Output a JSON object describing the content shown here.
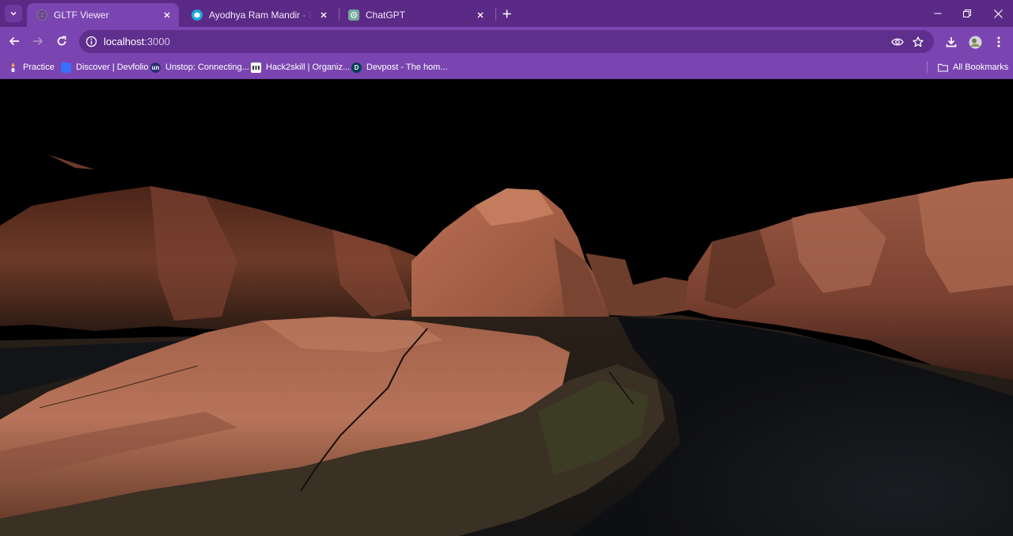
{
  "browser": {
    "tabs": [
      {
        "title": "GLTF Viewer",
        "active": true,
        "icon": "globe-icon"
      },
      {
        "title": "Ayodhya Ram Mandir - Downlo",
        "active": false,
        "icon": "sketchfab-icon"
      },
      {
        "title": "ChatGPT",
        "active": false,
        "icon": "chatgpt-icon"
      }
    ],
    "address": {
      "host": "localhost",
      "port": ":3000"
    },
    "bookmarks": [
      {
        "label": "Practice",
        "icon": "practice-icon"
      },
      {
        "label": "Discover | Devfolio",
        "icon": "devfolio-icon"
      },
      {
        "label": "Unstop: Connecting...",
        "icon": "unstop-icon",
        "glyph": "un"
      },
      {
        "label": "Hack2skill | Organiz...",
        "icon": "hack2skill-icon"
      },
      {
        "label": "Devpost - The hom...",
        "icon": "devpost-icon",
        "glyph": "D"
      }
    ],
    "all_bookmarks_label": "All Bookmarks"
  },
  "colors": {
    "tabstrip": "#5b2a86",
    "toolbar": "#7a45b0",
    "omnibox": "#5e2f8c",
    "viewport": "#000000",
    "rock": "#a86048",
    "road": "#14161a"
  },
  "viewer": {
    "scene": "3D GLTF canyon terrain render"
  }
}
